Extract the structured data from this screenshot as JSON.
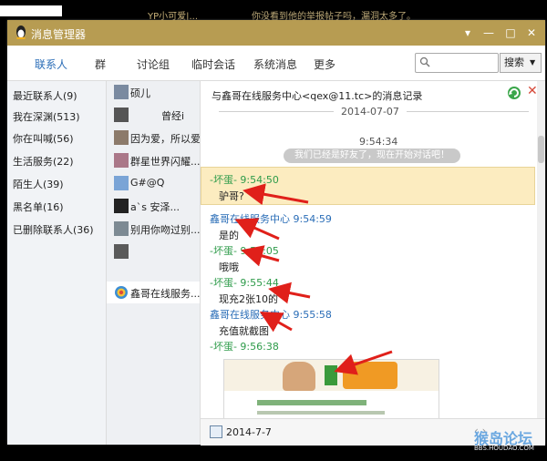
{
  "taskbar": {
    "text1": "YP小可爱|...",
    "text2": "你没看到他的举报帖子吗，漏洞太多了。"
  },
  "window": {
    "title": "消息管理器",
    "controls": [
      "▾",
      "—",
      "□",
      "✕"
    ]
  },
  "nav": {
    "tabs": [
      "联系人",
      "群",
      "讨论组",
      "临时会话",
      "系统消息",
      "更多"
    ],
    "search_placeholder": "",
    "search_button": "搜索"
  },
  "categories": [
    "最近联系人(9)",
    "我在深渊(513)",
    "你在叫喊(56)",
    "生活服务(22)",
    "陌生人(39)",
    "黑名单(16)",
    "已删除联系人(36)"
  ],
  "contacts": [
    {
      "name": "硕儿"
    },
    {
      "name": "曾经i"
    },
    {
      "name": "因为爱，所以爱"
    },
    {
      "name": "群星世界闪耀..."
    },
    {
      "name": "G#@Q"
    },
    {
      "name": "a`s    安泽..."
    },
    {
      "name": "别用你吻过别..."
    },
    {
      "name": ""
    },
    {
      "name": "鑫哥在线服务..."
    }
  ],
  "chat": {
    "header": "与鑫哥在线服务中心<qex@11.tc>的消息记录",
    "date": "2014-07-07",
    "first_time": "9:54:34",
    "system_notice": "我们已经是好友了，现在开始对话吧！",
    "messages": [
      {
        "sender": "-坏蛋- 9:54:50",
        "text": "驴哥?"
      },
      {
        "sender": "鑫哥在线服务中心 9:54:59",
        "text": "是的"
      },
      {
        "sender": "-坏蛋- 9:55:05",
        "text": "哦哦"
      },
      {
        "sender": "-坏蛋- 9:55:44",
        "text": "现充2张10的"
      },
      {
        "sender": "鑫哥在线服务中心 9:55:58",
        "text": "充值就截图"
      },
      {
        "sender": "-坏蛋- 9:56:38",
        "text": ""
      }
    ],
    "bottom_date": "2014-7-7",
    "pager": "‹ ›"
  },
  "watermark": {
    "main": "猴岛论坛",
    "sub": "BBS.HOUDAO.COM"
  },
  "colors": {
    "titlebar": "#b79c52",
    "highlight": "#fcecc0",
    "annotation_arrow": "#e0201a"
  }
}
